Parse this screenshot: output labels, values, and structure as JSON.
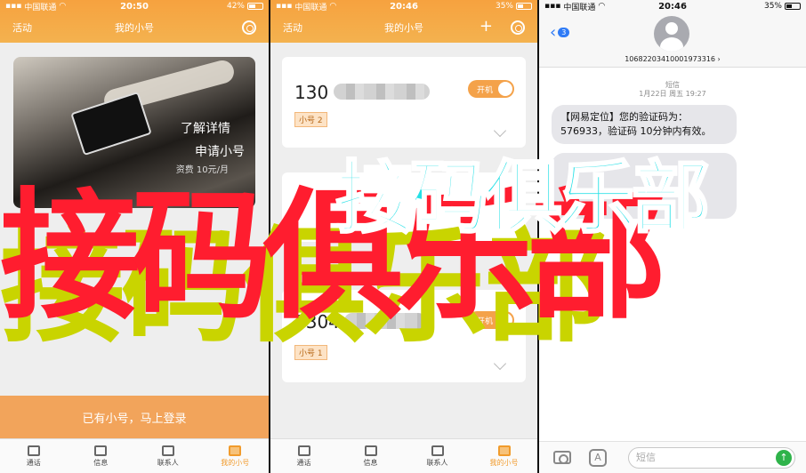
{
  "panel1": {
    "status": {
      "carrier": "中国联通",
      "time": "20:50",
      "battery": "42%"
    },
    "nav": {
      "left": "活动",
      "title": "我的小号"
    },
    "card": {
      "line1": "了解详情",
      "line2": "申请小号",
      "line3": "资费 10元/月"
    },
    "login_text": "已有小号，马上登录",
    "tabs": [
      {
        "label": "通话",
        "icon": "phone-icon"
      },
      {
        "label": "信息",
        "icon": "message-icon"
      },
      {
        "label": "联系人",
        "icon": "contacts-icon"
      },
      {
        "label": "我的小号",
        "icon": "my-number-icon"
      }
    ]
  },
  "panel2": {
    "status": {
      "carrier": "中国联通",
      "time": "20:46",
      "battery": "35%"
    },
    "nav": {
      "left": "活动",
      "title": "我的小号",
      "plus": "+"
    },
    "cards": [
      {
        "prefix": "130",
        "toggle": "开机",
        "tag": "小号 2"
      },
      {
        "prefix": "1304",
        "toggle": "开机",
        "tag": "小号 1"
      }
    ],
    "tabs": [
      {
        "label": "通话",
        "icon": "phone-icon"
      },
      {
        "label": "信息",
        "icon": "message-icon"
      },
      {
        "label": "联系人",
        "icon": "contacts-icon"
      },
      {
        "label": "我的小号",
        "icon": "my-number-icon"
      }
    ]
  },
  "panel3": {
    "status": {
      "carrier": "中国联通",
      "time": "20:46",
      "battery": "35%"
    },
    "back_badge": "3",
    "sender": "10682203410001973316 ›",
    "meta_type": "短信",
    "meta_date": "1月22日 周五 19:27",
    "message": "【网易定位】您的验证码为：576933，验证码 10分钟内有效。",
    "input_placeholder": "短信"
  },
  "watermark": {
    "yellow": "接码俱乐部",
    "red": "接码俱乐部",
    "cyan": "接码俱乐部"
  },
  "colors": {
    "accent": "#f6a23f",
    "link": "#2f7bf6",
    "send": "#2fb34a"
  }
}
